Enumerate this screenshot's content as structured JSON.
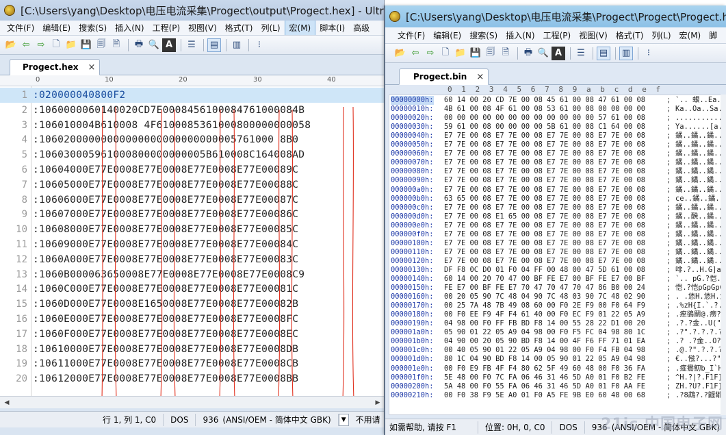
{
  "window1": {
    "title": "[C:\\Users\\yang\\Desktop\\电压电流采集\\Progect\\output\\Progect.hex] - Ultra",
    "menu": [
      "文件(F)",
      "编辑(E)",
      "搜索(S)",
      "插入(N)",
      "工程(P)",
      "视图(V)",
      "格式(T)",
      "列(L)",
      "宏(M)",
      "脚本(I)",
      "高级"
    ],
    "active_menu_index": 8,
    "tab_label": "Progect.hex",
    "tab_close": "×",
    "ruler": [
      "0",
      "10",
      "20",
      "30",
      "40"
    ],
    "lines": [
      {
        "num": "1",
        "text": ":020000040800F2"
      },
      {
        "num": "2",
        "text": ":1060000060140020CD7E0008456100084761000084B"
      },
      {
        "num": "3",
        "text": ":106010004B610008 4F6100085361000800000000058"
      },
      {
        "num": "4",
        "text": ":10602000000000000000000000000005761000 8B0"
      },
      {
        "num": "5",
        "text": ":106030005961000800000000005B610008C164008AD"
      },
      {
        "num": "6",
        "text": ":10604000E77E0008E77E0008E77E0008E77E00089C"
      },
      {
        "num": "7",
        "text": ":10605000E77E0008E77E0008E77E0008E77E00088C"
      },
      {
        "num": "8",
        "text": ":10606000E77E0008E77E0008E77E0008E77E00087C"
      },
      {
        "num": "9",
        "text": ":10607000E77E0008E77E0008E77E0008E77E00086C"
      },
      {
        "num": "10",
        "text": ":10608000E77E0008E77E0008E77E0008E77E00085C"
      },
      {
        "num": "11",
        "text": ":10609000E77E0008E77E0008E77E0008E77E00084C"
      },
      {
        "num": "12",
        "text": ":1060A000E77E0008E77E0008E77E0008E77E00083C"
      },
      {
        "num": "13",
        "text": ":1060B000063650008E77E0008E77E0008E77E0008C9"
      },
      {
        "num": "14",
        "text": ":1060C000E77E0008E77E0008E77E0008E77E00081C"
      },
      {
        "num": "15",
        "text": ":1060D000E77E0008E1650008E77E0008E77E00082B"
      },
      {
        "num": "16",
        "text": ":1060E000E77E0008E77E0008E77E0008E77E0008FC"
      },
      {
        "num": "17",
        "text": ":1060F000E77E0008E77E0008E77E0008E77E0008EC"
      },
      {
        "num": "18",
        "text": ":10610000E77E0008E77E0008E77E0008E77E0008DB"
      },
      {
        "num": "19",
        "text": ":10611000E77E0008E77E0008E77E0008E77E0008CB"
      },
      {
        "num": "20",
        "text": ":10612000E77E0008E77E0008E77E0008E77E0008BB"
      }
    ],
    "status": {
      "position": "行 1, 列 1, C0",
      "eol": "DOS",
      "codepage": "936",
      "encoding": "(ANSI/OEM - 简体中文 GBK)",
      "extra": "不用请"
    }
  },
  "window2": {
    "title": "[C:\\Users\\yang\\Desktop\\电压电流采集\\Progect\\Progect\\Progect.h",
    "menu": [
      "文件(F)",
      "编辑(E)",
      "搜索(S)",
      "插入(N)",
      "工程(P)",
      "视图(V)",
      "格式(T)",
      "列(L)",
      "宏(M)",
      "脚"
    ],
    "tab_label": "Progect.bin",
    "tab_close": "×",
    "hex_header": [
      "0",
      "1",
      "2",
      "3",
      "4",
      "5",
      "6",
      "7",
      "8",
      "9",
      "a",
      "b",
      "c",
      "d",
      "e",
      "f"
    ],
    "rows": [
      {
        "addr": "00000000h:",
        "bytes": "60 14 00 20 CD 7E 00 08 45 61 00 08 47 61 00 08",
        "ascii": "`.. 蛝..Ea..Ga.."
      },
      {
        "addr": "00000010h:",
        "bytes": "4B 61 00 08 4F 61 00 08 53 61 00 08 00 00 00 00",
        "ascii": "Ka..Oa..Sa......"
      },
      {
        "addr": "00000020h:",
        "bytes": "00 00 00 00 00 00 00 00 00 00 00 00 57 61 00 08",
        "ascii": "............Wa.."
      },
      {
        "addr": "00000030h:",
        "bytes": "59 61 00 08 00 00 00 00 5B 61 00 08 C1 64 00 08",
        "ascii": "Ya......[a..羒.."
      },
      {
        "addr": "00000040h:",
        "bytes": "E7 7E 00 08 E7 7E 00 08 E7 7E 00 08 E7 7E 00 08",
        "ascii": "鐍..鐍..鐍..鐍.."
      },
      {
        "addr": "00000050h:",
        "bytes": "E7 7E 00 08 E7 7E 00 08 E7 7E 00 08 E7 7E 00 08",
        "ascii": "鐍..鐍..鐍..鐍.."
      },
      {
        "addr": "00000060h:",
        "bytes": "E7 7E 00 08 E7 7E 00 08 E7 7E 00 08 E7 7E 00 08",
        "ascii": "鐍..鐍..鐍..鐍.."
      },
      {
        "addr": "00000070h:",
        "bytes": "E7 7E 00 08 E7 7E 00 08 E7 7E 00 08 E7 7E 00 08",
        "ascii": "鐍..鐍..鐍..鐍.."
      },
      {
        "addr": "00000080h:",
        "bytes": "E7 7E 00 08 E7 7E 00 08 E7 7E 00 08 E7 7E 00 08",
        "ascii": "鐍..鐍..鐍..鐍.."
      },
      {
        "addr": "00000090h:",
        "bytes": "E7 7E 00 08 E7 7E 00 08 E7 7E 00 08 E7 7E 00 08",
        "ascii": "鐍..鐍..鐍..鐍.."
      },
      {
        "addr": "000000a0h:",
        "bytes": "E7 7E 00 08 E7 7E 00 08 E7 7E 00 08 E7 7E 00 08",
        "ascii": "鐍..鐍..鐍..鐍.."
      },
      {
        "addr": "000000b0h:",
        "bytes": "63 65 00 08 E7 7E 00 08 E7 7E 00 08 E7 7E 00 08",
        "ascii": "ce..鐍..鐍..鐍.."
      },
      {
        "addr": "000000c0h:",
        "bytes": "E7 7E 00 08 E7 7E 00 08 E7 7E 00 08 E7 7E 00 08",
        "ascii": "鐍..鐍..鐍..鐍.."
      },
      {
        "addr": "000000d0h:",
        "bytes": "E7 7E 00 08 E1 65 00 08 E7 7E 00 08 E7 7E 00 08",
        "ascii": "鐍..醗..鐍..鐍.."
      },
      {
        "addr": "000000e0h:",
        "bytes": "E7 7E 00 08 E7 7E 00 08 E7 7E 00 08 E7 7E 00 08",
        "ascii": "鐍..鐍..鐍..鐍.."
      },
      {
        "addr": "000000f0h:",
        "bytes": "E7 7E 00 08 E7 7E 00 08 E7 7E 00 08 E7 7E 00 08",
        "ascii": "鐍..鐍..鐍..鐍.."
      },
      {
        "addr": "00000100h:",
        "bytes": "E7 7E 00 08 E7 7E 00 08 E7 7E 00 08 E7 7E 00 08",
        "ascii": "鐍..鐍..鐍..鐍.."
      },
      {
        "addr": "00000110h:",
        "bytes": "E7 7E 00 08 E7 7E 00 08 E7 7E 00 08 E7 7E 00 08",
        "ascii": "鐍..鐍..鐍..鐍.."
      },
      {
        "addr": "00000120h:",
        "bytes": "E7 7E 00 08 E7 7E 00 08 E7 7E 00 08 E7 7E 00 08",
        "ascii": "鐍..鐍..鐍..鐍.."
      },
      {
        "addr": "00000130h:",
        "bytes": "DF F8 0C D0 01 F0 04 FF 00 48 00 47 5D 61 00 08",
        "ascii": "啡.?..H.G]a.."
      },
      {
        "addr": "00000140h:",
        "bytes": "60 14 00 20 70 47 00 BF FE E7 00 BF FE E7 00 BF",
        "ascii": "`.. pG.?恺.?恺.?"
      },
      {
        "addr": "00000150h:",
        "bytes": "FE E7 00 BF FE E7 70 47 70 47 70 47 86 B0 00 24",
        "ascii": "恺.?恺pGpGpG啺.$"
      },
      {
        "addr": "00000160h:",
        "bytes": "00 20 05 90 7C 48 04 90 7C 48 03 90 7C 48 02 90",
        "ascii": ". .恷H.恷H.恷H.?"
      },
      {
        "addr": "00000170h:",
        "bytes": "00 25 7A 48 7B 49 08 60 00 F0 2E F9 00 F0 64 F9",
        "ascii": ".%zH{I.`.?.?d?"
      },
      {
        "addr": "00000180h:",
        "bytes": "00 F0 EE F9 4F F4 61 40 00 F0 EC F9 01 22 05 A9",
        "ascii": ".痤鵒鬭@.痨?\".?"
      },
      {
        "addr": "00000190h:",
        "bytes": "04 98 00 F0 FF FB BD F8 14 00 55 28 22 D1 00 20",
        "ascii": ".?.?金..U(\"?."
      },
      {
        "addr": "000001a0h:",
        "bytes": "05 90 01 22 05 A9 04 98 00 F0 F5 FC 04 98 80 1C",
        "ascii": ".?\".?.?.?.?."
      },
      {
        "addr": "000001b0h:",
        "bytes": "04 90 00 20 05 90 BD F8 14 00 4F F6 FF 71 01 EA",
        "ascii": ".? .?金..O?q.?"
      },
      {
        "addr": "000001c0h:",
        "bytes": "00 40 05 90 01 22 05 A9 04 98 00 F0 F4 FB 04 98",
        "ascii": ".@.?\".?.?.?.?"
      },
      {
        "addr": "000001d0h:",
        "bytes": "80 1C 04 90 BD F8 14 00 05 90 01 22 05 A9 04 98",
        "ascii": "€..惤?...?\".?."
      },
      {
        "addr": "000001e0h:",
        "bytes": "00 F0 E9 FB 4F F4 80 62 5F 49 60 48 00 F0 36 FA",
        "ascii": ".痖鸒魛b_I`H.?6?"
      },
      {
        "addr": "000001f0h:",
        "bytes": "5E 48 00 F0 7C FA 06 46 31 46 5D A0 01 F0 B2 FE",
        "ascii": "^H.?|?.F1F]?.?"
      },
      {
        "addr": "00000200h:",
        "bytes": "5A 48 00 F0 55 FA 06 46 31 46 5D A0 01 F0 AA FE",
        "ascii": "ZH.?U?.F1F]?.?"
      },
      {
        "addr": "00000210h:",
        "bytes": "00 F0 38 F9 5E A0 01 F0 A5 FE 9B E0 60 48 00 68",
        "ascii": ".?8鵡?.?鼴鄁H.h"
      }
    ],
    "status": {
      "help": "如需帮助, 请按 F1",
      "position": "位置: 0H, 0, C0",
      "eol": "DOS",
      "codepage": "936",
      "encoding": "(ANSI/OEM - 简体中文 GBK)"
    },
    "watermark": "21ic 中国电子网"
  },
  "colors": {
    "selection": "#cfe6f8",
    "annotation_red": "#e0301e",
    "hex_address": "#1f3aa8"
  }
}
